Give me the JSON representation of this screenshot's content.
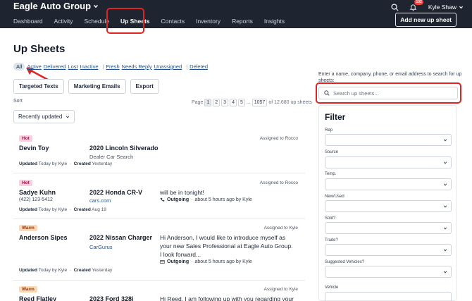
{
  "header": {
    "brand": "Eagle Auto Group",
    "nav": [
      "Dashboard",
      "Activity",
      "Schedule",
      "Up Sheets",
      "Contacts",
      "Inventory",
      "Reports",
      "Insights"
    ],
    "notif_count": "102",
    "user_name": "Kyle Shaw",
    "add_button": "Add new up sheet"
  },
  "page": {
    "title": "Up Sheets",
    "filter_all": "All",
    "filters_a": [
      "Active",
      "Delivered",
      "Lost",
      "Inactive"
    ],
    "filters_b": [
      "Fresh",
      "Needs Reply",
      "Unassigned"
    ],
    "filters_c": [
      "Deleted"
    ],
    "actions": [
      "Targeted Texts",
      "Marketing Emails",
      "Export"
    ],
    "sort_label": "Sort",
    "sort_value": "Recently updated",
    "pager": {
      "label": "Page",
      "pages": [
        "1",
        "2",
        "3",
        "4",
        "5"
      ],
      "ellipsis": "...",
      "last": "1057",
      "total": "of 12,680 up sheets"
    }
  },
  "upsheets": [
    {
      "tag": "Hot",
      "tag_type": "hot",
      "assigned": "Assigned to Rocco",
      "name": "Devin Toy",
      "phone": "",
      "vehicle": "2020 Lincoln Silverado",
      "source": "Dealer Car Search",
      "updated": "Today",
      "updated_by": "Kyle",
      "created": "Yesterday",
      "message": "",
      "activity": ""
    },
    {
      "tag": "Hot",
      "tag_type": "hot",
      "assigned": "Assigned to Rocco",
      "name": "Sadye Kuhn",
      "phone": "(422) 123-5412",
      "vehicle": "2022 Honda CR-V",
      "source": "cars.com",
      "updated": "Today",
      "updated_by": "Kyle",
      "created": "Aug 19",
      "message": "will be in tonight!",
      "activity_type": "Outgoing",
      "activity": "about 5 hours ago by Kyle"
    },
    {
      "tag": "Warm",
      "tag_type": "warm",
      "assigned": "Assigned to Kyle",
      "name": "Anderson Sipes",
      "phone": "",
      "vehicle": "2022 Nissan Charger",
      "source": "CarGurus",
      "updated": "Today",
      "updated_by": "Kyle",
      "created": "Yesterday",
      "message": "Hi Anderson, I would like to introduce myself as your new Sales Professional at Eagle Auto Group. I look forward...",
      "activity_type": "Outgoing",
      "activity": "about 5 hours ago by Kyle"
    },
    {
      "tag": "Warm",
      "tag_type": "warm",
      "assigned": "Assigned to Kyle",
      "name": "Reed Flatley",
      "phone": "",
      "vehicle": "2023 Ford 328i",
      "source": "",
      "message": "Hi Reed, I am following up with you regarding your"
    }
  ],
  "card_meta": {
    "updated_label": "Updated",
    "by_label": "by",
    "created_label": "Created"
  },
  "search": {
    "hint": "Enter a name, company, phone, or email address to search for up sheets:",
    "placeholder": "Search up sheets..."
  },
  "filter_panel": {
    "title": "Filter",
    "fields": [
      {
        "label": "Rep",
        "value": ""
      },
      {
        "label": "Source",
        "value": ""
      },
      {
        "label": "Temp.",
        "value": ""
      },
      {
        "label": "New/Used",
        "value": ""
      },
      {
        "label": "Sold?",
        "value": ""
      },
      {
        "label": "Trade?",
        "value": ""
      },
      {
        "label": "Suggested Vehicles?",
        "value": ""
      },
      {
        "label": "Vehicle",
        "value": ""
      }
    ]
  },
  "colors": {
    "topbar": "#1e2530",
    "annotation": "#e02424",
    "hot": "#fbcfe0",
    "warm": "#fcd9b6",
    "link": "#1f4e8c"
  }
}
